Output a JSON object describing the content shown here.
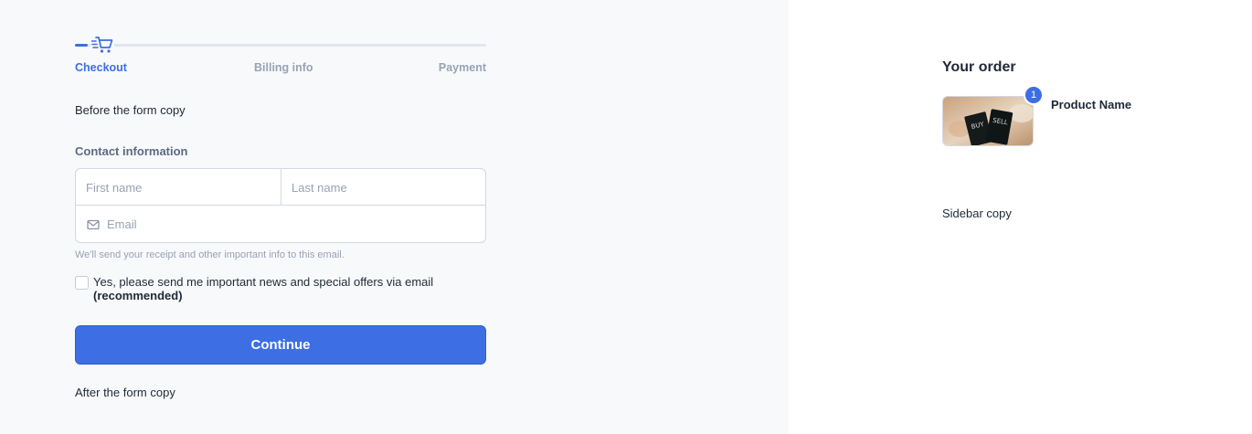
{
  "steps": [
    {
      "label": "Checkout",
      "active": true
    },
    {
      "label": "Billing info",
      "active": false
    },
    {
      "label": "Payment",
      "active": false
    }
  ],
  "before_copy": "Before the form copy",
  "contact": {
    "title": "Contact information",
    "first_name_placeholder": "First name",
    "last_name_placeholder": "Last name",
    "email_placeholder": "Email",
    "helper": "We'll send your receipt and other important info to this email."
  },
  "consent": {
    "text": "Yes, please send me important news and special offers via email",
    "emphasis": "(recommended)",
    "checked": false
  },
  "continue_label": "Continue",
  "after_copy": "After the form copy",
  "order": {
    "title": "Your order",
    "product_name": "Product Name",
    "quantity": "1",
    "image_words": [
      "BUY",
      "SELL"
    ]
  },
  "sidebar_copy": "Sidebar copy",
  "icons": {
    "cart": "shopping-cart-icon",
    "email": "envelope-icon"
  },
  "colors": {
    "accent": "#3d6ee3",
    "main_bg": "#f8f9fb",
    "muted": "#97a3b6"
  }
}
